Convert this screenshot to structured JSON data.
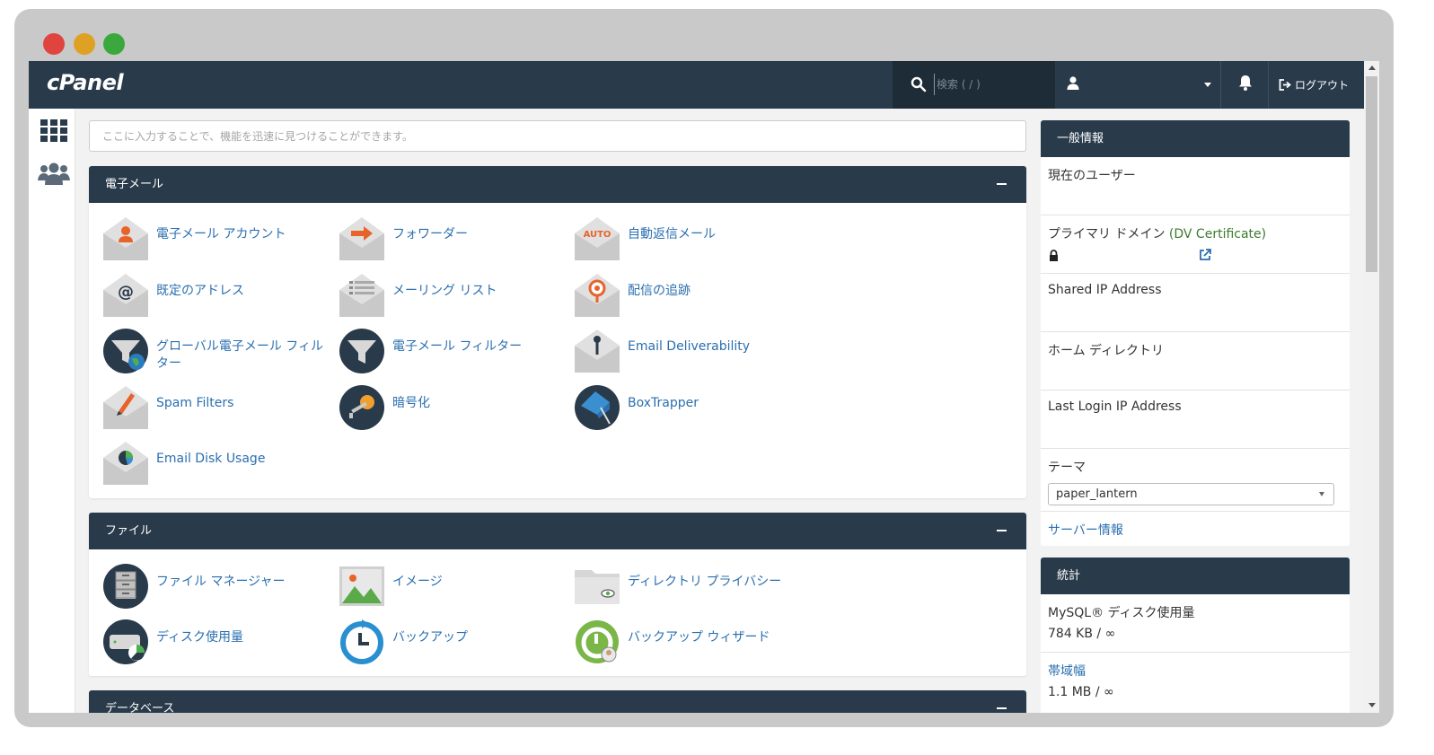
{
  "brand": {
    "logo": "cPanel"
  },
  "topbar": {
    "search_placeholder": "検索 ( / )",
    "logout_label": "ログアウト"
  },
  "quick_search": {
    "placeholder": "ここに入力することで、機能を迅速に見つけることができます。"
  },
  "sections": {
    "email": {
      "title": "電子メール",
      "items": [
        "電子メール アカウント",
        "フォワーダー",
        "自動返信メール",
        "既定のアドレス",
        "メーリング リスト",
        "配信の追跡",
        "グローバル電子メール フィルター",
        "電子メール フィルター",
        "Email Deliverability",
        "Spam Filters",
        "暗号化",
        "BoxTrapper",
        "Email Disk Usage"
      ]
    },
    "files": {
      "title": "ファイル",
      "items": [
        "ファイル マネージャー",
        "イメージ",
        "ディレクトリ プライバシー",
        "ディスク使用量",
        "バックアップ",
        "バックアップ ウィザード"
      ]
    },
    "database": {
      "title": "データベース"
    }
  },
  "general_info": {
    "title": "一般情報",
    "current_user_label": "現在のユーザー",
    "primary_domain_label": "プライマリ ドメイン",
    "primary_domain_cert": "(DV Certificate)",
    "shared_ip_label": "Shared IP Address",
    "home_dir_label": "ホーム ディレクトリ",
    "last_login_label": "Last Login IP Address",
    "theme_label": "テーマ",
    "theme_value": "paper_lantern",
    "server_info_link": "サーバー情報"
  },
  "stats": {
    "title": "統計",
    "mysql_label": "MySQL® ディスク使用量",
    "mysql_value": "784 KB / ∞",
    "bandwidth_label": "帯域幅",
    "bandwidth_value": "1.1 MB / ∞"
  },
  "colors": {
    "header": "#293a4a",
    "link": "#2a6fb0",
    "accent_orange": "#e8632a"
  }
}
